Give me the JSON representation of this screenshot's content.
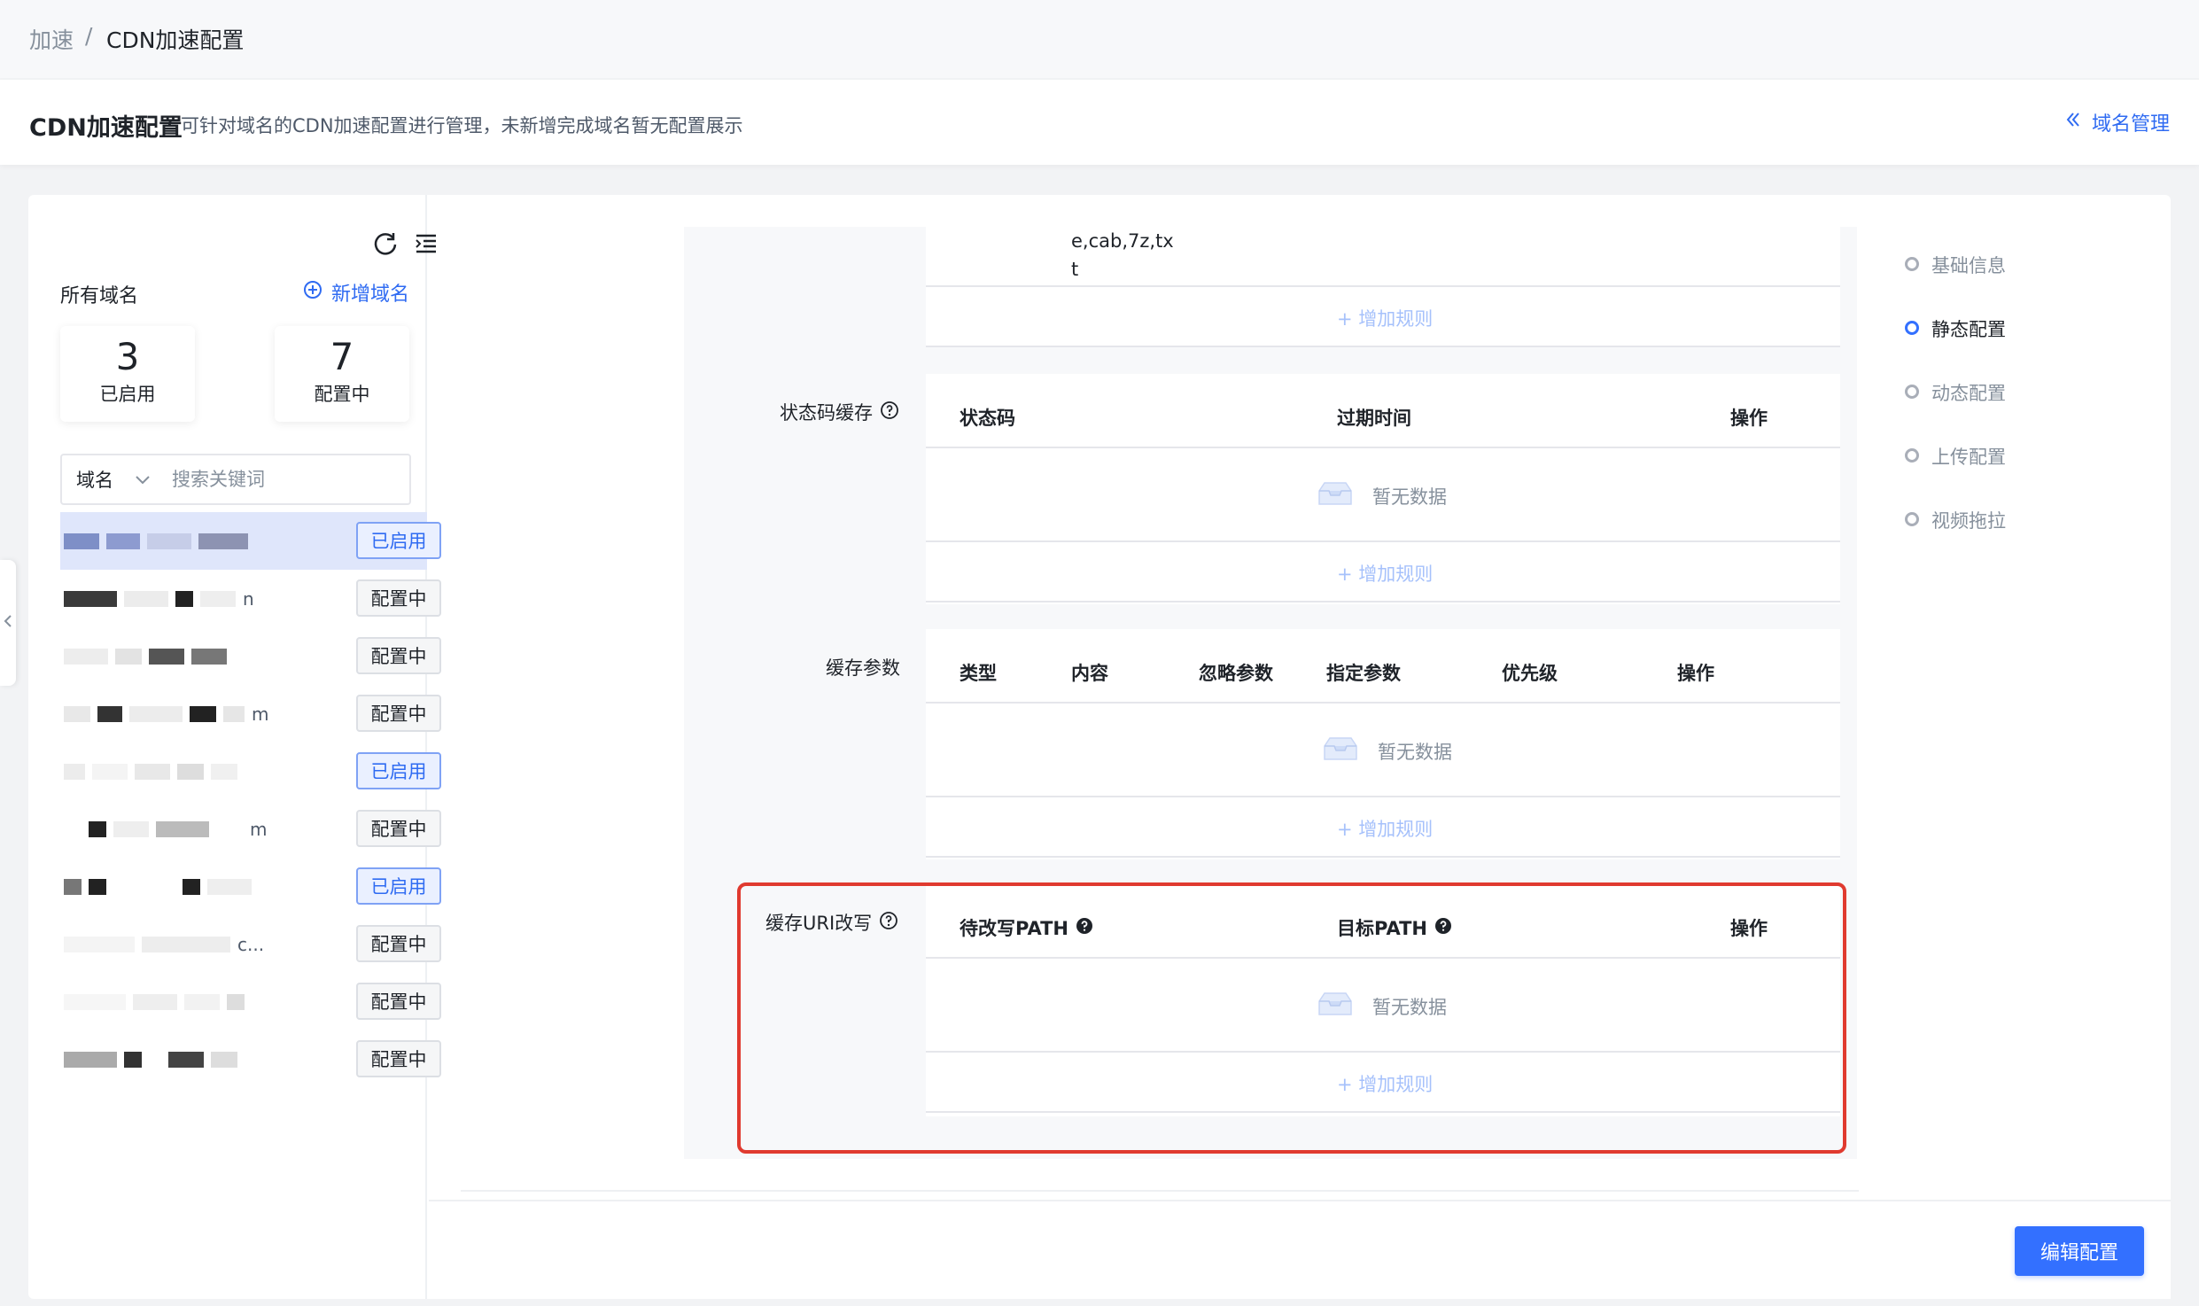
{
  "breadcrumb": {
    "parent": "加速",
    "separator": "/",
    "current": "CDN加速配置"
  },
  "header": {
    "title": "CDN加速配置",
    "description": "可针对域名的CDN加速配置进行管理，未新增完成域名暂无配置展示",
    "domain_mgmt_link": "域名管理"
  },
  "sidebar": {
    "all_domains_label": "所有域名",
    "add_domain_label": "新增域名",
    "stats": {
      "enabled": {
        "count": "3",
        "label": "已启用"
      },
      "configuring": {
        "count": "7",
        "label": "配置中"
      }
    },
    "search": {
      "filter_value": "域名",
      "placeholder": "搜索关键词"
    },
    "domains": [
      {
        "name_fragment": "",
        "status": "已启用",
        "enabled": true
      },
      {
        "name_fragment": "n",
        "status": "配置中",
        "enabled": false
      },
      {
        "name_fragment": "",
        "status": "配置中",
        "enabled": false
      },
      {
        "name_fragment": "m",
        "status": "配置中",
        "enabled": false
      },
      {
        "name_fragment": "",
        "status": "已启用",
        "enabled": true
      },
      {
        "name_fragment": "m",
        "status": "配置中",
        "enabled": false
      },
      {
        "name_fragment": "",
        "status": "已启用",
        "enabled": true
      },
      {
        "name_fragment": "c...",
        "status": "配置中",
        "enabled": false
      },
      {
        "name_fragment": "",
        "status": "配置中",
        "enabled": false
      },
      {
        "name_fragment": "",
        "status": "配置中",
        "enabled": false
      }
    ]
  },
  "content": {
    "top_table": {
      "cell_text_line1": "e,cab,7z,tx",
      "cell_text_line2": "t",
      "add_rule": "+ 增加规则"
    },
    "status_code_cache": {
      "label": "状态码缓存",
      "columns": [
        "状态码",
        "过期时间",
        "操作"
      ],
      "empty_text": "暂无数据",
      "add_rule": "+ 增加规则"
    },
    "cache_params": {
      "label": "缓存参数",
      "columns": [
        "类型",
        "内容",
        "忽略参数",
        "指定参数",
        "优先级",
        "操作"
      ],
      "empty_text": "暂无数据",
      "add_rule": "+ 增加规则"
    },
    "uri_rewrite": {
      "label": "缓存URI改写",
      "columns": [
        "待改写PATH",
        "目标PATH",
        "操作"
      ],
      "empty_text": "暂无数据",
      "add_rule": "+ 增加规则"
    }
  },
  "anchor_nav": [
    {
      "label": "基础信息",
      "active": false
    },
    {
      "label": "静态配置",
      "active": true
    },
    {
      "label": "动态配置",
      "active": false
    },
    {
      "label": "上传配置",
      "active": false
    },
    {
      "label": "视频拖拉",
      "active": false
    }
  ],
  "footer": {
    "edit_button": "编辑配置"
  },
  "colors": {
    "primary": "#3370ff",
    "highlight": "#e03a2f",
    "enabled_border": "#7fa2f5"
  }
}
